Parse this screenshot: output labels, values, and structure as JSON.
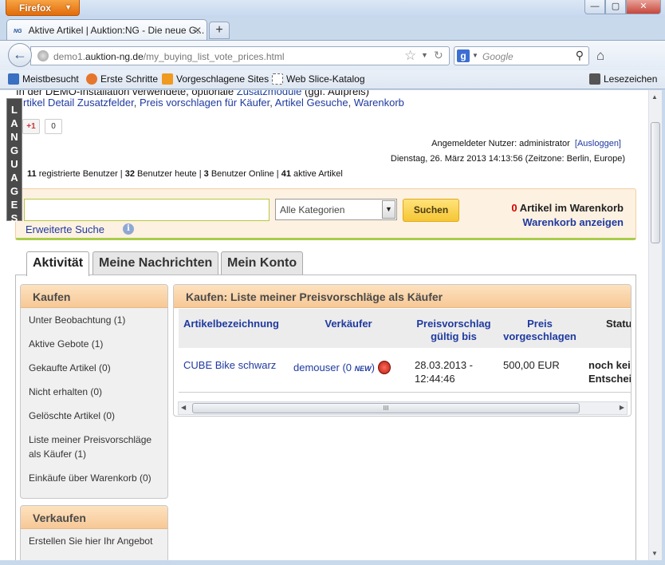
{
  "browser": {
    "menu_button": "Firefox",
    "window_controls": {
      "minimize": "—",
      "maximize": "▢",
      "close": "✕"
    },
    "tab": {
      "favicon": "NG",
      "title": "Aktive Artikel | Auktion:NG - Die neue G...",
      "close": "✕"
    },
    "new_tab": "+",
    "url": {
      "prefix": "demo1.",
      "domain": "auktion-ng.de",
      "path": "/my_buying_list_vote_prices.html"
    },
    "search_engine": "g",
    "search_placeholder": "Google",
    "bookmarks": [
      {
        "label": "Meistbesucht",
        "color": "#3a6fc1"
      },
      {
        "label": "Erste Schritte",
        "color": "#e6762d"
      },
      {
        "label": "Vorgeschlagene Sites",
        "color": "#f09a20"
      },
      {
        "label": "Web Slice-Katalog",
        "color": "#ffffff"
      }
    ],
    "bookmarks_menu": "Lesezeichen"
  },
  "page": {
    "languages_label": [
      "L",
      "A",
      "N",
      "G",
      "U",
      "A",
      "G",
      "E",
      "S"
    ],
    "top_cut_text": "In der DEMO-Installation verwendete, optionale ",
    "top_cut_link": "Zusatzmodule",
    "top_cut_tail": " (ggf. Aufpreis)",
    "links": [
      "rtikel Detail Zusatzfelder",
      "Preis vorschlagen für Käufer",
      "Artikel Gesuche",
      "Warenkorb"
    ],
    "gplus_label": "+1",
    "gplus_count": "0",
    "user_label": "Angemeldeter Nutzer: administrator",
    "logout_label": "[Ausloggen]",
    "date_text": "Dienstag, 26. März 2013 14:13:56 (Zeitzone: Berlin, Europe)",
    "stats": {
      "registered_count": "11",
      "registered_label": "registrierte Benutzer",
      "today_count": "32",
      "today_label": "Benutzer heute",
      "online_count": "3",
      "online_label": "Benutzer Online",
      "active_count": "41",
      "active_label": "aktive Artikel"
    },
    "search": {
      "category_selected": "Alle Kategorien",
      "button": "Suchen",
      "extended": "Erweiterte Suche",
      "cart_count": "0",
      "cart_count_label": "Artikel im Warenkorb",
      "cart_link": "Warenkorb anzeigen"
    },
    "tabs": [
      "Aktivität",
      "Meine Nachrichten",
      "Mein Konto"
    ],
    "kaufen": {
      "title": "Kaufen",
      "items": [
        "Unter Beobachtung (1)",
        "Aktive Gebote (1)",
        "Gekaufte Artikel (0)",
        "Nicht erhalten (0)",
        "Gelöschte Artikel (0)",
        "Liste meiner Preisvorschläge als Käufer (1)",
        "Einkäufe über Warenkorb (0)"
      ]
    },
    "verkaufen": {
      "title": "Verkaufen",
      "items": [
        "Erstellen Sie hier Ihr Angebot"
      ]
    },
    "main": {
      "title": "Kaufen: Liste meiner Preisvorschläge als Käufer",
      "columns": [
        "Artikelbezeichnung",
        "Verkäufer",
        "Preisvorschlag gültig bis",
        "Preis vorgeschlagen",
        "Status"
      ],
      "rows": [
        {
          "article": "CUBE Bike schwarz",
          "seller": "demouser",
          "seller_rating": "(0",
          "seller_new": "NEW",
          "seller_close": ")",
          "valid_until_date": "28.03.2013 -",
          "valid_until_time": "12:44:46",
          "price": "500,00 EUR",
          "status_line1": "noch keine",
          "status_line2": "Entscheidung"
        }
      ],
      "scroll_grip": "III"
    }
  }
}
